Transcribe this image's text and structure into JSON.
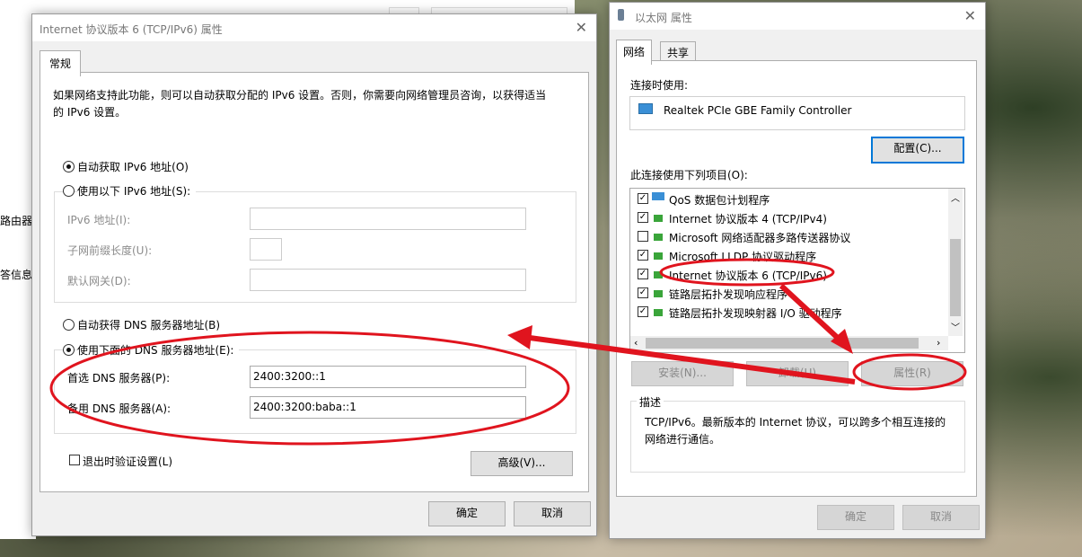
{
  "bg_window": {
    "left_labels": [
      "路由器",
      "答信息."
    ]
  },
  "ipv6_dialog": {
    "title": "Internet 协议版本 6 (TCP/IPv6) 属性",
    "tab_general": "常规",
    "intro": [
      "如果网络支持此功能，则可以自动获取分配的 IPv6 设置。否则，你需要向网络管理员咨询，以获得适当",
      "的 IPv6 设置。"
    ],
    "radio_auto_ip": "自动获取 IPv6 地址(O)",
    "radio_manual_ip": "使用以下 IPv6 地址(S):",
    "label_ipv6_addr": "IPv6 地址(I):",
    "label_prefix": "子网前缀长度(U):",
    "label_gateway": "默认网关(D):",
    "radio_auto_dns": "自动获得 DNS 服务器地址(B)",
    "radio_manual_dns": "使用下面的 DNS 服务器地址(E):",
    "label_preferred_dns": "首选 DNS 服务器(P):",
    "preferred_dns_value": "2400:3200::1",
    "label_alternate_dns": "备用 DNS 服务器(A):",
    "alternate_dns_value": "2400:3200:baba::1",
    "validate_on_exit": "退出时验证设置(L)",
    "advanced_button": "高级(V)...",
    "ok_button": "确定",
    "cancel_button": "取消"
  },
  "ethernet_dialog": {
    "title": "以太网 属性",
    "tab_network": "网络",
    "tab_sharing": "共享",
    "connect_using_label": "连接时使用:",
    "adapter_name": "Realtek PCIe GBE Family Controller",
    "configure_button": "配置(C)...",
    "items_label": "此连接使用下列项目(O):",
    "items": [
      {
        "label": "QoS 数据包计划程序",
        "checked": true
      },
      {
        "label": "Internet 协议版本 4 (TCP/IPv4)",
        "checked": true
      },
      {
        "label": "Microsoft 网络适配器多路传送器协议",
        "checked": false
      },
      {
        "label": "Microsoft LLDP 协议驱动程序",
        "checked": true
      },
      {
        "label": "Internet 协议版本 6 (TCP/IPv6)",
        "checked": true
      },
      {
        "label": "链路层拓扑发现响应程序",
        "checked": true
      },
      {
        "label": "链路层拓扑发现映射器 I/O 驱动程序",
        "checked": true
      }
    ],
    "install_button": "安装(N)...",
    "uninstall_button": "卸载(U)",
    "properties_button": "属性(R)",
    "description_label": "描述",
    "description_text": [
      "TCP/IPv6。最新版本的 Internet 协议，可以跨多个相互连接的",
      "网络进行通信。"
    ],
    "ok_button": "确定",
    "cancel_button": "取消"
  },
  "annotation_color": "#e0141e"
}
